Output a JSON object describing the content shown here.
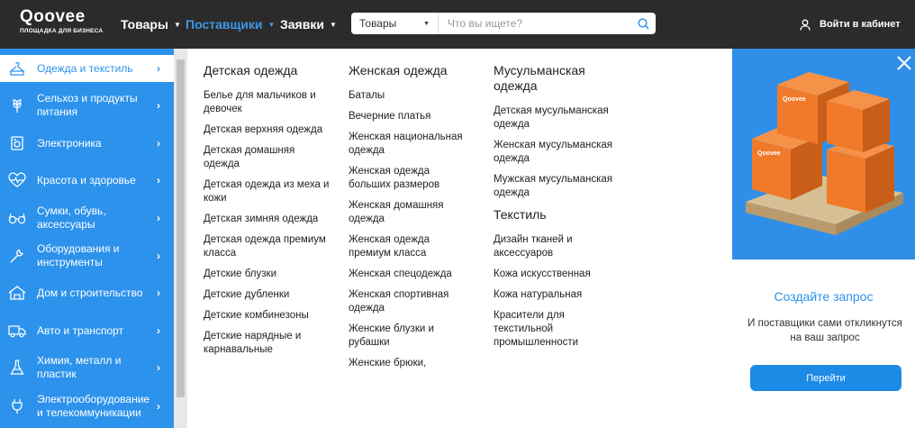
{
  "header": {
    "logo_text": "Qoovee",
    "logo_tagline": "ПЛОЩАДКА ДЛЯ БИЗНЕСА",
    "nav": [
      {
        "label": "Товары",
        "active": false
      },
      {
        "label": "Поставщики",
        "active": true
      },
      {
        "label": "Заявки",
        "active": false
      }
    ],
    "search": {
      "category": "Товары",
      "placeholder": "Что вы ищете?",
      "value": ""
    },
    "login_label": "Войти в кабинет"
  },
  "sidebar": {
    "items": [
      {
        "label": "Одежда и текстиль",
        "icon": "clothes-hanger-icon",
        "active": true
      },
      {
        "label": "Сельхоз и продукты питания",
        "icon": "wheat-icon",
        "active": false
      },
      {
        "label": "Электроника",
        "icon": "appliance-icon",
        "active": false
      },
      {
        "label": "Красота и здоровье",
        "icon": "heart-pulse-icon",
        "active": false
      },
      {
        "label": "Сумки, обувь, аксессуары",
        "icon": "glasses-icon",
        "active": false
      },
      {
        "label": "Оборудования и инструменты",
        "icon": "wrench-icon",
        "active": false
      },
      {
        "label": "Дом и строительство",
        "icon": "house-icon",
        "active": false
      },
      {
        "label": "Авто и транспорт",
        "icon": "truck-icon",
        "active": false
      },
      {
        "label": "Химия, металл и пластик",
        "icon": "flask-icon",
        "active": false
      },
      {
        "label": "Электрооборудование и телекоммуникации",
        "icon": "plug-icon",
        "active": false
      }
    ]
  },
  "columns": [
    {
      "title": "Детская одежда",
      "links": [
        "Белье для мальчиков и девочек",
        "Детская верхняя одежда",
        "Детская домашняя одежда",
        "Детская одежда из меха и кожи",
        "Детская зимняя одежда",
        "Детская одежда премиум класса",
        "Детские блузки",
        "Детские дубленки",
        "Детские комбинезоны",
        "Детские нарядные и карнавальные"
      ]
    },
    {
      "title": "Женская одежда",
      "links": [
        "Баталы",
        "Вечерние платья",
        "Женская национальная одежда",
        "Женская одежда больших размеров",
        "Женская домашняя одежда",
        "Женская одежда премиум класса",
        "Женская спецодежда",
        "Женская спортивная одежда",
        "Женские блузки и рубашки",
        "Женские брюки,"
      ]
    },
    {
      "title": "Мусульманская одежда",
      "links": [
        "Детская мусульманская одежда",
        "Женская мусульманская одежда",
        "Мужская мусульманская одежда"
      ],
      "sub_title": "Текстиль",
      "sub_links": [
        "Дизайн тканей и аксессуаров",
        "Кожа искусственная",
        "Кожа натуральная",
        "Красители для текстильной промышленности"
      ]
    }
  ],
  "promo": {
    "box_brand": "Qoovee",
    "title": "Создайте запрос",
    "text": "И поставщики сами откликнутся на ваш запрос",
    "button_label": "Перейти"
  },
  "colors": {
    "topbar": "#2b2b2b",
    "accent": "#2c92ec",
    "button": "#1d8ae6",
    "box": "#f07a2a"
  }
}
